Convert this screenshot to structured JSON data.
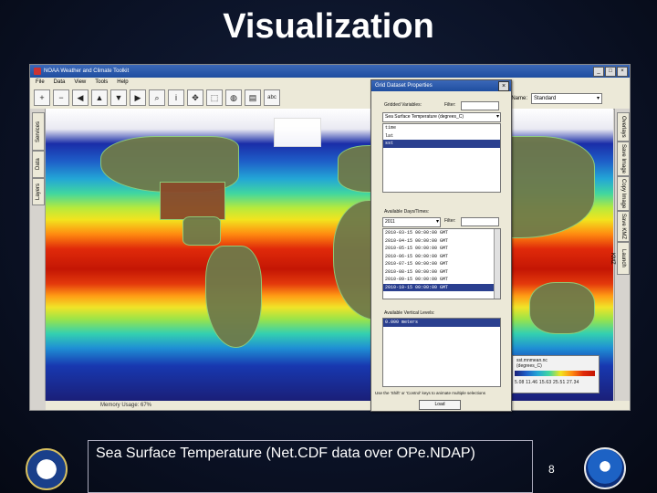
{
  "slide": {
    "title": "Visualization",
    "caption": "Sea Surface Temperature (Net.CDF data over OPe.NDAP)",
    "page_number": "8"
  },
  "app": {
    "window_title": "NOAA Weather and Climate Toolkit",
    "menu": [
      "File",
      "Data",
      "View",
      "Tools",
      "Help"
    ],
    "toolbar_icons": [
      "zoom-in-icon",
      "zoom-out-icon",
      "arrow-left-icon",
      "arrow-up-icon",
      "arrow-down-icon",
      "arrow-right-icon",
      "zoom-tool-icon",
      "info-icon",
      "pan-icon",
      "select-icon",
      "globe-icon",
      "chart-icon",
      "abc-icon"
    ],
    "view_name_label": "Map Name:",
    "view_name_value": "Standard",
    "left_tabs": [
      "Layers",
      "Data",
      "Services"
    ],
    "right_tabs": [
      "Overlays",
      "Save Image",
      "Copy Image",
      "Save KMZ",
      "Launch KMZ"
    ],
    "status": "Memory Usage: 67%",
    "legend": {
      "title": "sst.mnmean.nc",
      "subtitle": "(degrees_C)",
      "ticks": "5.08  11.46  15.63  25.51  27.34"
    }
  },
  "dialog": {
    "title": "Grid Dataset Properties",
    "gridded_variables_label": "Gridded Variables:",
    "filter_label": "Filter:",
    "variable_dropdown": "Sea Surface Temperature (degrees_C)",
    "variables": [
      "time",
      "lat",
      "sst"
    ],
    "selected_variable": "sst",
    "times_label": "Available Days/Times:",
    "times_dropdown": "2011",
    "times": [
      "2010-03-15 00:00:00 GMT",
      "2010-04-15 00:00:00 GMT",
      "2010-05-15 00:00:00 GMT",
      "2010-06-15 00:00:00 GMT",
      "2010-07-15 00:00:00 GMT",
      "2010-08-15 00:00:00 GMT",
      "2010-09-15 00:00:00 GMT",
      "2010-10-15 00:00:00 GMT"
    ],
    "selected_time_index": 7,
    "levels_label": "Available Vertical Levels:",
    "levels": [
      "0.000 meters"
    ],
    "hint": "Use the 'Shift' or 'Control' keys to animate multiple selections",
    "load_button": "Load"
  }
}
